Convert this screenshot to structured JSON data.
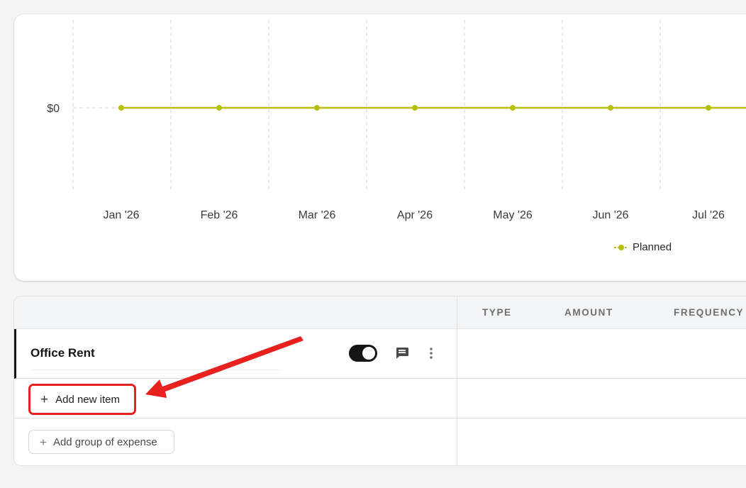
{
  "chart_data": {
    "type": "line",
    "categories": [
      "Jan '26",
      "Feb '26",
      "Mar '26",
      "Apr '26",
      "May '26",
      "Jun '26",
      "Jul '26"
    ],
    "series": [
      {
        "name": "Planned",
        "values": [
          0,
          0,
          0,
          0,
          0,
          0,
          0
        ],
        "color": "#b8bf0e"
      }
    ],
    "y_tick_labels": [
      "$0"
    ],
    "grid": true,
    "legend_position": "bottom-right"
  },
  "table": {
    "columns": [
      "TYPE",
      "AMOUNT",
      "FREQUENCY"
    ],
    "group_name": "Office Rent",
    "toggle_on": true,
    "add_item_label": "Add new item",
    "add_group_label": "Add group of expense"
  },
  "icons": {
    "toggle": "toggle-switch-icon",
    "comment": "comment-icon",
    "more": "more-vertical-icon",
    "plus": "plus-icon",
    "annotation": "red-arrow-annotation"
  },
  "colors": {
    "accent_line": "#b8bf0e",
    "highlight": "#e8201e",
    "toggle": "#151515"
  }
}
